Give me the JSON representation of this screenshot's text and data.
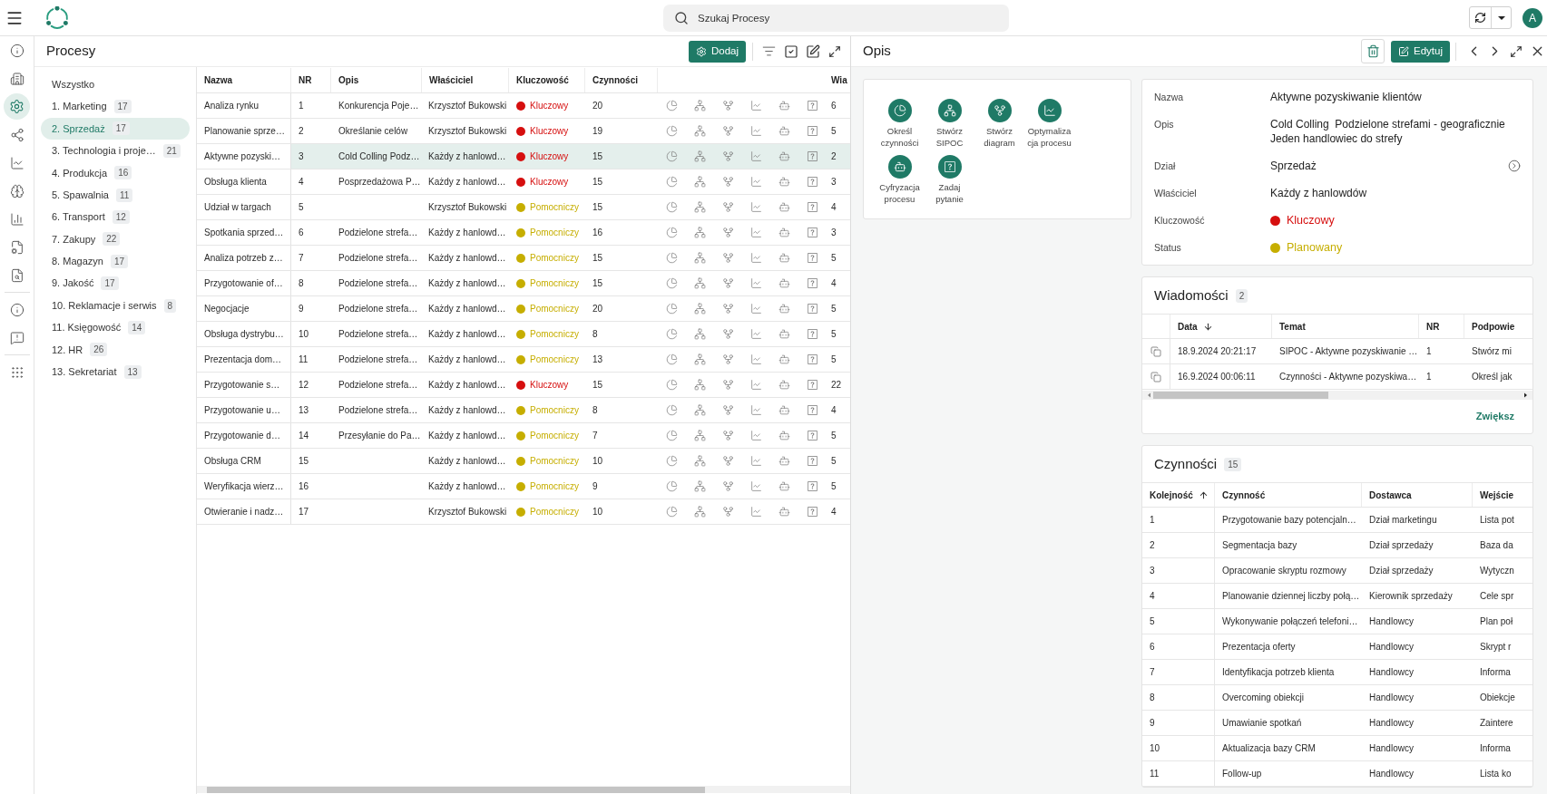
{
  "top_bar": {
    "search": {
      "placeholder": "Szukaj Procesy"
    },
    "avatar": "A"
  },
  "nav_rail": [
    [
      {
        "kind": "info",
        "selected": false
      },
      {
        "kind": "building",
        "selected": false
      },
      {
        "kind": "gears",
        "selected": true
      },
      {
        "kind": "nodes",
        "selected": false
      },
      {
        "kind": "trend",
        "selected": false
      },
      {
        "kind": "brain",
        "selected": false
      },
      {
        "kind": "bars",
        "selected": false
      },
      {
        "kind": "config",
        "selected": false
      },
      {
        "kind": "inspect",
        "selected": false
      }
    ],
    [
      {
        "kind": "help",
        "selected": false
      },
      {
        "kind": "feedback",
        "selected": false
      }
    ],
    [
      {
        "kind": "apps",
        "selected": false
      }
    ]
  ],
  "processes": {
    "title": "Procesy",
    "add_button": "Dodaj",
    "categories": [
      {
        "label": "Wszystko",
        "selected": false
      },
      {
        "label": "1. Marketing",
        "count": "17",
        "selected": false
      },
      {
        "label": "2. Sprzedaż",
        "count": "17",
        "selected": true
      },
      {
        "label": "3. Technologia i proje…",
        "count": "21",
        "selected": false
      },
      {
        "label": "4. Produkcja",
        "count": "16",
        "selected": false
      },
      {
        "label": "5. Spawalnia",
        "count": "11",
        "selected": false
      },
      {
        "label": "6. Transport",
        "count": "12",
        "selected": false
      },
      {
        "label": "7. Zakupy",
        "count": "22",
        "selected": false
      },
      {
        "label": "8. Magazyn",
        "count": "17",
        "selected": false
      },
      {
        "label": "9. Jakość",
        "count": "17",
        "selected": false
      },
      {
        "label": "10. Reklamacje i serwis",
        "count": "8",
        "selected": false
      },
      {
        "label": "11. Księgowość",
        "count": "14",
        "selected": false
      },
      {
        "label": "12. HR",
        "count": "26",
        "selected": false
      },
      {
        "label": "13. Sekretariat",
        "count": "13",
        "selected": false
      }
    ],
    "table": {
      "columns": [
        {
          "label": "Nazwa"
        },
        {
          "label": "NR"
        },
        {
          "label": "Opis"
        },
        {
          "label": "Właściciel"
        },
        {
          "label": "Kluczowość"
        },
        {
          "label": "Czynności"
        },
        {
          "label": "Wia"
        }
      ],
      "rows": [
        {
          "name": "Analiza rynku",
          "number": "1",
          "description": "Konkurencja Poje…",
          "owner": "Krzysztof Bukowski",
          "priority": {
            "label": "Kluczowy",
            "color": "#d60f0f"
          },
          "activities": "20",
          "column_8": "6",
          "selected": false
        },
        {
          "name": "Planowanie sprze…",
          "number": "2",
          "description": "Określanie celów",
          "owner": "Krzysztof Bukowski",
          "priority": {
            "label": "Kluczowy",
            "color": "#d60f0f"
          },
          "activities": "19",
          "column_8": "5",
          "selected": false
        },
        {
          "name": "Aktywne pozyski…",
          "number": "3",
          "description": "Cold Colling Podz…",
          "owner": "Każdy z hanlowd…",
          "priority": {
            "label": "Kluczowy",
            "color": "#d60f0f"
          },
          "activities": "15",
          "column_8": "2",
          "selected": true
        },
        {
          "name": "Obsługa klienta",
          "number": "4",
          "description": "Posprzedażowa P…",
          "owner": "Każdy z hanlowd…",
          "priority": {
            "label": "Kluczowy",
            "color": "#d60f0f"
          },
          "activities": "15",
          "column_8": "3",
          "selected": false
        },
        {
          "name": "Udział w targach",
          "number": "5",
          "owner": "Krzysztof Bukowski",
          "priority": {
            "label": "Pomocniczy",
            "color": "#c6ae00"
          },
          "activities": "15",
          "column_8": "4",
          "selected": false
        },
        {
          "name": "Spotkania sprzed…",
          "number": "6",
          "description": "Podzielone strefa…",
          "owner": "Każdy z hanlowd…",
          "priority": {
            "label": "Pomocniczy",
            "color": "#c6ae00"
          },
          "activities": "16",
          "column_8": "3",
          "selected": false
        },
        {
          "name": "Analiza potrzeb z…",
          "number": "7",
          "description": "Podzielone strefa…",
          "owner": "Każdy z hanlowd…",
          "priority": {
            "label": "Pomocniczy",
            "color": "#c6ae00"
          },
          "activities": "15",
          "column_8": "5",
          "selected": false
        },
        {
          "name": "Przygotowanie of…",
          "number": "8",
          "description": "Podzielone strefa…",
          "owner": "Każdy z hanlowd…",
          "priority": {
            "label": "Pomocniczy",
            "color": "#c6ae00"
          },
          "activities": "15",
          "column_8": "4",
          "selected": false
        },
        {
          "name": "Negocjacje",
          "number": "9",
          "description": "Podzielone strefa…",
          "owner": "Każdy z hanlowd…",
          "priority": {
            "label": "Pomocniczy",
            "color": "#c6ae00"
          },
          "activities": "20",
          "column_8": "5",
          "selected": false
        },
        {
          "name": "Obsługa dystrybu…",
          "number": "10",
          "description": "Podzielone strefa…",
          "owner": "Każdy z hanlowd…",
          "priority": {
            "label": "Pomocniczy",
            "color": "#c6ae00"
          },
          "activities": "8",
          "column_8": "5",
          "selected": false
        },
        {
          "name": "Prezentacja dom…",
          "number": "11",
          "description": "Podzielone strefa…",
          "owner": "Każdy z hanlowd…",
          "priority": {
            "label": "Pomocniczy",
            "color": "#c6ae00"
          },
          "activities": "13",
          "column_8": "5",
          "selected": false
        },
        {
          "name": "Przygotowanie s…",
          "number": "12",
          "description": "Podzielone strefa…",
          "owner": "Każdy z hanlowd…",
          "priority": {
            "label": "Kluczowy",
            "color": "#d60f0f"
          },
          "activities": "15",
          "column_8": "22",
          "selected": false
        },
        {
          "name": "Przygotowanie u…",
          "number": "13",
          "description": "Podzielone strefa…",
          "owner": "Każdy z hanlowd…",
          "priority": {
            "label": "Pomocniczy",
            "color": "#c6ae00"
          },
          "activities": "8",
          "column_8": "4",
          "selected": false
        },
        {
          "name": "Przygotowanie d…",
          "number": "14",
          "description": "Przesyłanie do Pa…",
          "owner": "Każdy z hanlowd…",
          "priority": {
            "label": "Pomocniczy",
            "color": "#c6ae00"
          },
          "activities": "7",
          "column_8": "5",
          "selected": false
        },
        {
          "name": "Obsługa CRM",
          "number": "15",
          "owner": "Każdy z hanlowd…",
          "priority": {
            "label": "Pomocniczy",
            "color": "#c6ae00"
          },
          "activities": "10",
          "column_8": "5",
          "selected": false
        },
        {
          "name": "Weryfikacja wierz…",
          "number": "16",
          "owner": "Każdy z hanlowd…",
          "priority": {
            "label": "Pomocniczy",
            "color": "#c6ae00"
          },
          "activities": "9",
          "column_8": "5",
          "selected": false
        },
        {
          "name": "Otwieranie i nadz…",
          "number": "17",
          "owner": "Krzysztof Bukowski",
          "priority": {
            "label": "Pomocniczy",
            "color": "#c6ae00"
          },
          "activities": "10",
          "column_8": "4",
          "selected": false
        }
      ]
    }
  },
  "detail": {
    "title": "Opis",
    "edit_button": "Edytuj",
    "actions": [
      {
        "kind": "activities",
        "label": "Określ czynności"
      },
      {
        "kind": "sipoc",
        "label": "Stwórz SIPOC"
      },
      {
        "kind": "diagram",
        "label": "Stwórz diagram"
      },
      {
        "kind": "optimize",
        "label": "Optymalizacja procesu"
      },
      {
        "kind": "digitize",
        "label": "Cyfryzacja procesu"
      },
      {
        "kind": "question",
        "label": "Zadaj pytanie"
      }
    ],
    "fields": [
      {
        "kind": "text",
        "label": "Nazwa",
        "value": "Aktywne pozyskiwanie klientów"
      },
      {
        "kind": "text",
        "label": "Opis",
        "value": "Cold Colling  Podzielone strefami - geograficznie\nJeden handlowiec do strefy"
      },
      {
        "kind": "link",
        "label": "Dział",
        "value": "Sprzedaż"
      },
      {
        "kind": "text",
        "label": "Właściciel",
        "value": "Każdy z hanlowdów"
      },
      {
        "kind": "status",
        "label": "Kluczowość",
        "value": "Kluczowy",
        "color": "#d60f0f"
      },
      {
        "kind": "status",
        "label": "Status",
        "value": "Planowany",
        "color": "#c6ae00"
      }
    ],
    "messages": {
      "title": "Wiadomości",
      "count": "2",
      "columns": [
        {
          "label": "Data",
          "sorted": true,
          "descending": true
        },
        {
          "label": "Temat",
          "sorted": false
        },
        {
          "label": "NR",
          "sorted": false
        },
        {
          "label": "Podpowie",
          "sorted": false
        }
      ],
      "rows": [
        {
          "date": "18.9.2024 20:21:17",
          "topic": "SIPOC - Aktywne pozyskiwanie …",
          "number": "1",
          "column_5": "Stwórz mi"
        },
        {
          "date": "16.9.2024 00:06:11",
          "topic": "Czynności - Aktywne pozyskiwa…",
          "number": "1",
          "column_5": "Określ jak"
        }
      ],
      "more_button": "Zwiększ"
    },
    "activities": {
      "title": "Czynności",
      "count": "15",
      "columns": [
        {
          "label": "Kolejność",
          "sorted": true,
          "descending": false
        },
        {
          "label": "Czynność",
          "sorted": false
        },
        {
          "label": "Dostawca",
          "sorted": false
        },
        {
          "label": "Wejście",
          "sorted": false
        }
      ],
      "rows": [
        {
          "order": "1",
          "activity": "Przygotowanie bazy potencjaln…",
          "supplier": "Dział marketingu",
          "input": "Lista pot"
        },
        {
          "order": "2",
          "activity": "Segmentacja bazy",
          "supplier": "Dział sprzedaży",
          "input": "Baza da"
        },
        {
          "order": "3",
          "activity": "Opracowanie skryptu rozmowy",
          "supplier": "Dział sprzedaży",
          "input": "Wytyczn"
        },
        {
          "order": "4",
          "activity": "Planowanie dziennej liczby połą…",
          "supplier": "Kierownik sprzedaży",
          "input": "Cele spr"
        },
        {
          "order": "5",
          "activity": "Wykonywanie połączeń telefoni…",
          "supplier": "Handlowcy",
          "input": "Plan poł"
        },
        {
          "order": "6",
          "activity": "Prezentacja oferty",
          "supplier": "Handlowcy",
          "input": "Skrypt r"
        },
        {
          "order": "7",
          "activity": "Identyfikacja potrzeb klienta",
          "supplier": "Handlowcy",
          "input": "Informa"
        },
        {
          "order": "8",
          "activity": "Overcoming obiekcji",
          "supplier": "Handlowcy",
          "input": "Obiekcje"
        },
        {
          "order": "9",
          "activity": "Umawianie spotkań",
          "supplier": "Handlowcy",
          "input": "Zaintere"
        },
        {
          "order": "10",
          "activity": "Aktualizacja bazy CRM",
          "supplier": "Handlowcy",
          "input": "Informa"
        },
        {
          "order": "11",
          "activity": "Follow-up",
          "supplier": "Handlowcy",
          "input": "Lista ko"
        }
      ]
    }
  }
}
